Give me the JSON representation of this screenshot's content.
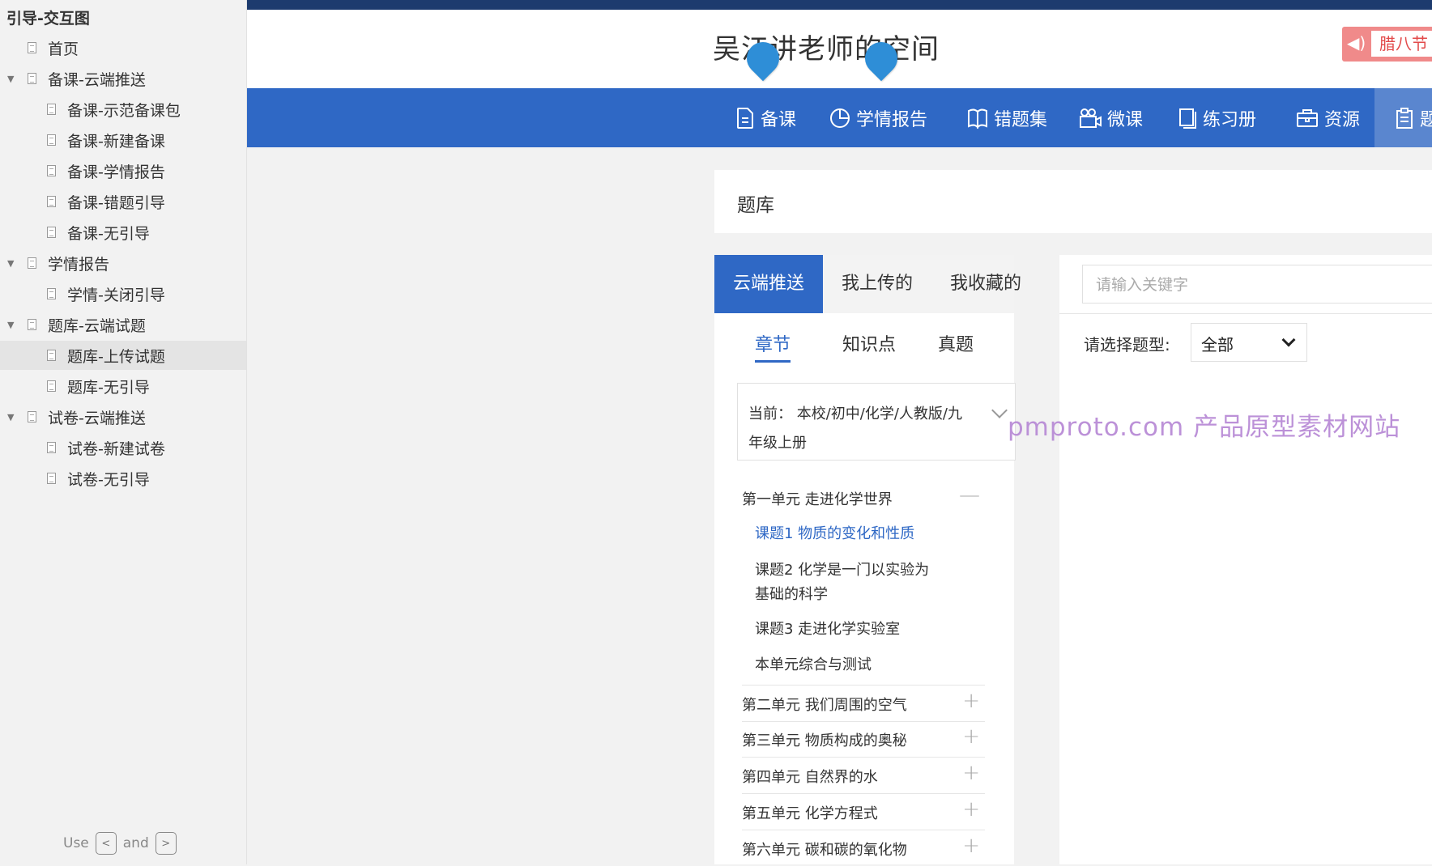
{
  "sidebar": {
    "title": "引导-交互图",
    "items": [
      {
        "label": "首页"
      },
      {
        "label": "备课-云端推送"
      },
      {
        "label": "备课-示范备课包"
      },
      {
        "label": "备课-新建备课"
      },
      {
        "label": "备课-学情报告"
      },
      {
        "label": "备课-错题引导"
      },
      {
        "label": "备课-无引导"
      },
      {
        "label": "学情报告"
      },
      {
        "label": "学情-关闭引导"
      },
      {
        "label": "题库-云端试题"
      },
      {
        "label": "题库-上传试题"
      },
      {
        "label": "题库-无引导"
      },
      {
        "label": "试卷-云端推送"
      },
      {
        "label": "试卷-新建试卷"
      },
      {
        "label": "试卷-无引导"
      }
    ],
    "selected_index": 10,
    "hint": {
      "use": "Use",
      "and": "and",
      "key_prev": "<",
      "key_next": ">"
    }
  },
  "header": {
    "site_title": "吴江讲老师的空间",
    "promo_text": "腊八节",
    "promo_icon": "speaker-icon"
  },
  "nav": {
    "items": [
      {
        "label": "备课",
        "icon": "document-icon"
      },
      {
        "label": "学情报告",
        "icon": "pie-chart-icon"
      },
      {
        "label": "错题集",
        "icon": "book-icon"
      },
      {
        "label": "微课",
        "icon": "video-camera-icon"
      },
      {
        "label": "练习册",
        "icon": "notebook-icon"
      },
      {
        "label": "资源",
        "icon": "briefcase-icon"
      },
      {
        "label": "题",
        "icon": "clipboard-icon"
      }
    ],
    "active_index": 6
  },
  "panel": {
    "title": "题库"
  },
  "source_tabs": [
    "云端推送",
    "我上传的",
    "我收藏的"
  ],
  "source_active": 0,
  "sub_tabs": [
    "章节",
    "知识点",
    "真题"
  ],
  "sub_active": 0,
  "scope": {
    "text": "当前： 本校/初中/化学/人教版/九年级上册"
  },
  "units": [
    {
      "label": "第一单元 走进化学世界",
      "sign": "—"
    },
    {
      "label": "第二单元 我们周围的空气",
      "sign": "+"
    },
    {
      "label": "第三单元 物质构成的奥秘",
      "sign": "+"
    },
    {
      "label": "第四单元 自然界的水",
      "sign": "+"
    },
    {
      "label": "第五单元 化学方程式",
      "sign": "+"
    },
    {
      "label": "第六单元 碳和碳的氧化物",
      "sign": "+"
    }
  ],
  "lessons": [
    {
      "label": "课题1 物质的变化和性质"
    },
    {
      "label": "课题2 化学是一门以实验为基础的科学"
    },
    {
      "label": "课题3 走进化学实验室"
    },
    {
      "label": "本单元综合与测试"
    }
  ],
  "search": {
    "placeholder": "请输入关键字"
  },
  "filter": {
    "label": "请选择题型:",
    "value": "全部"
  },
  "watermark": "pmproto.com 产品原型素材网站",
  "colors": {
    "primary": "#2f68c5",
    "topbar": "#1d3b6e",
    "pin": "#2e8ed7",
    "promo": "#f08a8a",
    "watermark": "#b98cd6"
  }
}
